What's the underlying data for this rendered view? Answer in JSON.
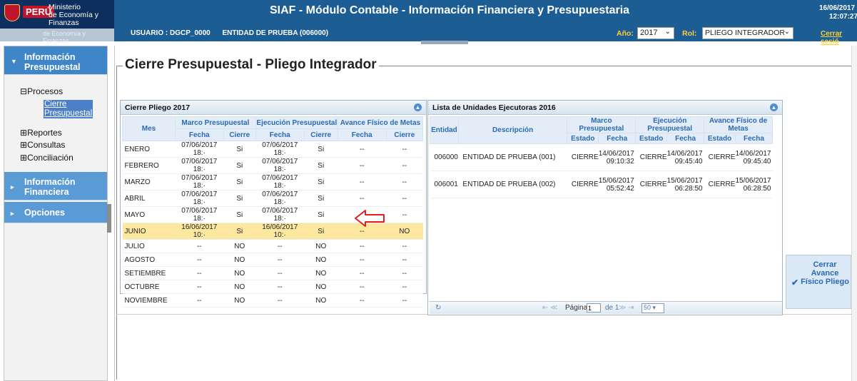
{
  "header": {
    "peru": "PERÚ",
    "ministry_line1": "Ministerio",
    "ministry_line2": "de Economía y Finanzas",
    "ministry_faded": "de Economía y Finanzas",
    "title": "SIAF - Módulo Contable - Información Financiera y Presupuestaria",
    "usuario": "USUARIO : DGCP_0000",
    "entidad": "ENTIDAD DE PRUEBA (006000)",
    "anio_label": "Año:",
    "anio_value": "2017",
    "rol_label": "Rol:",
    "rol_value": "PLIEGO INTEGRADOR",
    "date": "16/06/2017",
    "time": "12:07:27",
    "logout": "Cerrar sesió"
  },
  "sidebar": {
    "info_presupuestal": "Información Presupuestal",
    "procesos": "Procesos",
    "cierre_presupuestal_1": "Cierre",
    "cierre_presupuestal_2": "Presupuestal",
    "reportes": "Reportes",
    "consultas": "Consultas",
    "conciliacion": "Conciliación",
    "info_financiera": "Información Financiera",
    "opciones": "Opciones"
  },
  "page": {
    "title": "Cierre Presupuestal - Pliego Integrador"
  },
  "left_panel": {
    "title": "Cierre Pliego 2017",
    "col_mes": "Mes",
    "grp_marco": "Marco Presupuestal",
    "grp_ejecucion": "Ejecución Presupuestal",
    "grp_avance": "Avance Físico de Metas",
    "col_fecha": "Fecha",
    "col_cierre": "Cierre",
    "rows": [
      {
        "mes": "ENERO",
        "mf": "07/06/2017 18:·",
        "mc": "Si",
        "ef": "07/06/2017 18:·",
        "ec": "Si",
        "af": "--",
        "ac": "--"
      },
      {
        "mes": "FEBRERO",
        "mf": "07/06/2017 18:·",
        "mc": "Si",
        "ef": "07/06/2017 18:·",
        "ec": "Si",
        "af": "--",
        "ac": "--"
      },
      {
        "mes": "MARZO",
        "mf": "07/06/2017 18:·",
        "mc": "Si",
        "ef": "07/06/2017 18:·",
        "ec": "Si",
        "af": "--",
        "ac": "--"
      },
      {
        "mes": "ABRIL",
        "mf": "07/06/2017 18:·",
        "mc": "Si",
        "ef": "07/06/2017 18:·",
        "ec": "Si",
        "af": "--",
        "ac": "--"
      },
      {
        "mes": "MAYO",
        "mf": "07/06/2017 18:·",
        "mc": "Si",
        "ef": "07/06/2017 18:·",
        "ec": "Si",
        "af": "--",
        "ac": "--"
      },
      {
        "mes": "JUNIO",
        "mf": "16/06/2017 10:·",
        "mc": "Si",
        "ef": "16/06/2017 10:·",
        "ec": "Si",
        "af": "--",
        "ac": "NO"
      },
      {
        "mes": "JULIO",
        "mf": "--",
        "mc": "NO",
        "ef": "--",
        "ec": "NO",
        "af": "--",
        "ac": "--"
      },
      {
        "mes": "AGOSTO",
        "mf": "--",
        "mc": "NO",
        "ef": "--",
        "ec": "NO",
        "af": "--",
        "ac": "--"
      },
      {
        "mes": "SETIEMBRE",
        "mf": "--",
        "mc": "NO",
        "ef": "--",
        "ec": "NO",
        "af": "--",
        "ac": "--"
      },
      {
        "mes": "OCTUBRE",
        "mf": "--",
        "mc": "NO",
        "ef": "--",
        "ec": "NO",
        "af": "--",
        "ac": "--"
      },
      {
        "mes": "NOVIEMBRE",
        "mf": "--",
        "mc": "NO",
        "ef": "--",
        "ec": "NO",
        "af": "--",
        "ac": "--"
      }
    ]
  },
  "right_panel": {
    "title": "Lista de Unidades Ejecutoras 2016",
    "col_entidad": "Entidad",
    "col_descripcion": "Descripción",
    "grp_marco": "Marco Presupuestal",
    "grp_ejecucion": "Ejecución Presupuestal",
    "grp_avance": "Avance Físico de Metas",
    "col_estado": "Estado",
    "col_fecha": "Fecha",
    "rows": [
      {
        "entidad": "006000",
        "desc": "ENTIDAD DE PRUEBA (001)",
        "me": "CIERRE",
        "mf1": "14/06/2017",
        "mf2": "09:10:32",
        "ee": "CIERRE",
        "ef1": "14/06/2017",
        "ef2": "09:45:40",
        "ae": "CIERRE",
        "af1": "14/06/2017",
        "af2": "09:45:40"
      },
      {
        "entidad": "006001",
        "desc": "ENTIDAD DE PRUEBA (002)",
        "me": "CIERRE",
        "mf1": "15/06/2017",
        "mf2": "05:52:42",
        "ee": "CIERRE",
        "ef1": "15/06/2017",
        "ef2": "06:28:50",
        "ae": "CIERRE",
        "af1": "15/06/2017",
        "af2": "06:28:50"
      }
    ],
    "pager_label": "Página",
    "pager_page": "1",
    "pager_of": "de 1",
    "pager_size": "50"
  },
  "actions": {
    "cerrar_avance": "Cerrar Avance Físico Pliego"
  },
  "colors": {
    "header_bg": "#1c5d94",
    "selected_row": "#fde8a0",
    "annotation_arrow": "#e02020"
  }
}
